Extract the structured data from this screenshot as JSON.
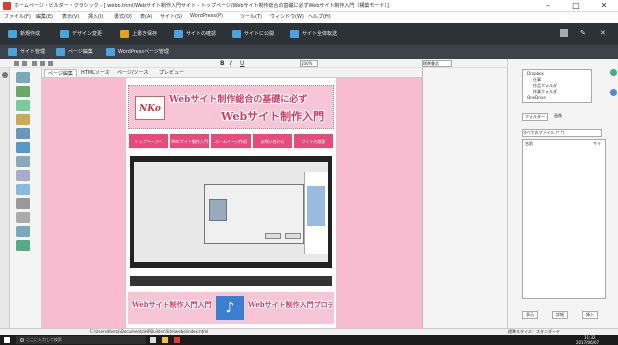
{
  "window": {
    "title": "ホームページ・ビルダー・クラシック - [ webo.html/Webサイト制作入門サイト - トップページ/Webサイト制作総合の基礎に必ずWebサイト制作入門（構築モード）]",
    "minimize": "–",
    "maximize": "□",
    "close": "✕"
  },
  "menu": [
    "ファイル(F)",
    "編集(E)",
    "表示(V)",
    "挿入(I)",
    "書式(O)",
    "表(A)",
    "サイト(S)",
    "WordPress(P)",
    "ツール(T)",
    "ウィンドウ(W)",
    "ヘルプ(H)"
  ],
  "toolbar1": [
    {
      "label": "新規作成",
      "color": "#4aa3df"
    },
    {
      "label": "デザイン変更",
      "color": "#4aa3df"
    },
    {
      "label": "上書き保存",
      "color": "#e0a020"
    },
    {
      "label": "サイトの確認",
      "color": "#4aa3df"
    },
    {
      "label": "サイトに公開",
      "color": "#4aa3df"
    },
    {
      "label": "サイト全体転送",
      "color": "#4aa3df"
    }
  ],
  "toolbar2": [
    {
      "label": "サイト管理",
      "color": "#4aa3df"
    },
    {
      "label": "ページ編集",
      "color": "#4aa3df"
    },
    {
      "label": "WordPressページ管理",
      "color": "#4aa3df"
    }
  ],
  "tabs": [
    "ページ編集",
    "HTMLソース",
    "ページ/ソース",
    "プレビュー"
  ],
  "zoom": "100%",
  "style_select": "標準書式",
  "editor_page": {
    "logo": "NKo",
    "header_line1": "Webサイト制作総合の基礎に必ず",
    "header_line2": "Webサイト制作入門",
    "nav": [
      "トップページへ",
      "Webサイト制作入門",
      "ホームページ作成",
      "お問い合わせ",
      "サイト内検索"
    ],
    "bottom_left": "Webサイト制作入門入門",
    "bottom_right": "Webサイト制作入門プロデューサー"
  },
  "right_panel": {
    "tree": [
      "Dropbox",
      "仕事",
      "作品フォルダ",
      "作業フォルダ",
      "OneDrive"
    ],
    "tabs": [
      "フォルダー",
      "画像"
    ],
    "files_header": "すべてのファイル (*.*)",
    "col_name": "名前",
    "col_size": "サイ",
    "bottom_buttons": [
      "表示",
      "詳細",
      "挿入"
    ]
  },
  "status": {
    "path": "C:\\Users\\Kenta\\Documents\\HPBuilder\\Site\\webo\\index.html",
    "style": "標準スタイル：スタンダード"
  },
  "taskbar": {
    "search_placeholder": "ここに入力して検索",
    "time": "11:32",
    "date": "2017/06/07"
  },
  "colors": {
    "canvas_bg": "#f8bcd0",
    "accent": "#e84a7a",
    "toolbar_dark": "#2d3237"
  }
}
